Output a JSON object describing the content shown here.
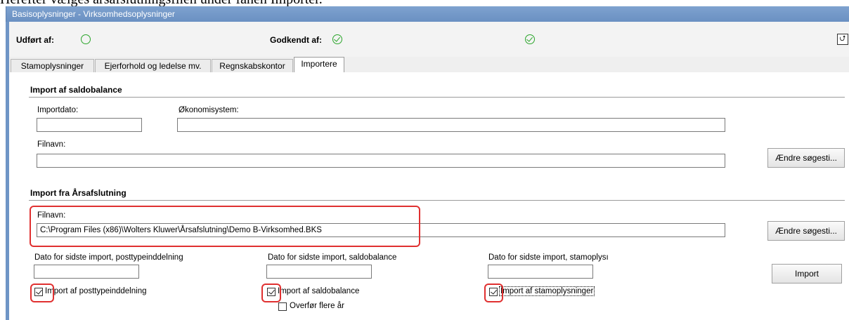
{
  "document_text": "Herefter vælges årsafslutningsfilen under fanen Importer.",
  "window": {
    "title": "Basisoplysninger - Virksomhedsoplysninger"
  },
  "status": {
    "performed_label": "Udført af:",
    "approved_label": "Godkendt af:"
  },
  "tabs": [
    {
      "label": "Stamoplysninger"
    },
    {
      "label": "Ejerforhold og ledelse mv."
    },
    {
      "label": "Regnskabskontor"
    },
    {
      "label": "Importere"
    }
  ],
  "import_balance": {
    "title": "Import af saldobalance",
    "import_date_label": "Importdato:",
    "import_date_value": "",
    "system_label": "Økonomisystem:",
    "system_value": "",
    "filename_label": "Filnavn:",
    "filename_value": "",
    "change_path_button": "Ændre søgesti..."
  },
  "import_year_end": {
    "title": "Import fra Årsafslutning",
    "filename_label": "Filnavn:",
    "filename_value": "C:\\Program Files (x86)\\Wolters Kluwer\\Årsafslutning\\Demo B-Virksomhed.BKS",
    "change_path_button": "Ændre søgesti...",
    "date_posting_label": "Dato for sidste import, posttypeinddelning",
    "date_balance_label": "Dato for sidste import, saldobalance",
    "date_master_label": "Dato for sidste import, stamoplysı",
    "import_button": "Import",
    "check_posting_label": "Import af posttypeinddelning",
    "check_posting_checked": true,
    "check_balance_label": "Import af saldobalance",
    "check_balance_checked": true,
    "check_master_label": "Import af stamoplysninger",
    "check_master_checked": true,
    "check_years_label": "Overfør flere år",
    "check_years_checked": false
  },
  "colors": {
    "titlebar": "#6f95c6",
    "highlight": "#e03030",
    "status_ok": "#2aa52a"
  }
}
